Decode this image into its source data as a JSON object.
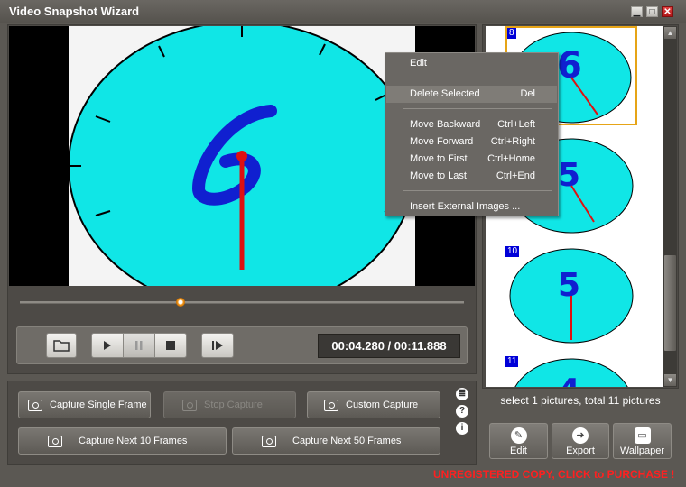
{
  "window": {
    "title": "Video Snapshot Wizard",
    "min_icon": "minimize-icon",
    "max_icon": "maximize-icon",
    "close_icon": "close-icon"
  },
  "player": {
    "timecode": "00:04.280 / 00:11.888",
    "position_fraction": 0.36,
    "video_digit": "6",
    "buttons": [
      "open-folder-icon",
      "play-icon",
      "pause-icon",
      "stop-icon",
      "next-frame-icon"
    ]
  },
  "capture": {
    "single": "Capture Single Frame",
    "stop": "Stop Capture",
    "custom": "Custom Capture",
    "next10": "Capture Next 10 Frames",
    "next50": "Capture Next 50 Frames"
  },
  "side_icons": {
    "list": "≣",
    "help": "?",
    "info": "i"
  },
  "thumbnails": {
    "items": [
      {
        "number": "8",
        "selected": true
      },
      {
        "number": "9",
        "selected": false
      },
      {
        "number": "10",
        "selected": false
      },
      {
        "number": "11",
        "selected": false
      }
    ],
    "status": "select 1 pictures, total 11 pictures"
  },
  "actions": {
    "edit": "Edit",
    "export": "Export",
    "wallpaper": "Wallpaper"
  },
  "banner": "UNREGISTERED COPY, CLICK to PURCHASE !",
  "context_menu": {
    "items": [
      {
        "label": "Edit",
        "shortcut": ""
      },
      {
        "label": "Delete Selected",
        "shortcut": "Del"
      },
      {
        "label": "Move Backward",
        "shortcut": "Ctrl+Left"
      },
      {
        "label": "Move Forward",
        "shortcut": "Ctrl+Right"
      },
      {
        "label": "Move to First",
        "shortcut": "Ctrl+Home"
      },
      {
        "label": "Move to Last",
        "shortcut": "Ctrl+End"
      },
      {
        "label": "Insert External Images ...",
        "shortcut": ""
      }
    ]
  },
  "colors": {
    "clock_face": "#10e6e6",
    "digit": "#1020d0",
    "hand": "#e01010",
    "accent_selection": "#e6a417",
    "warning": "#ff2020"
  }
}
